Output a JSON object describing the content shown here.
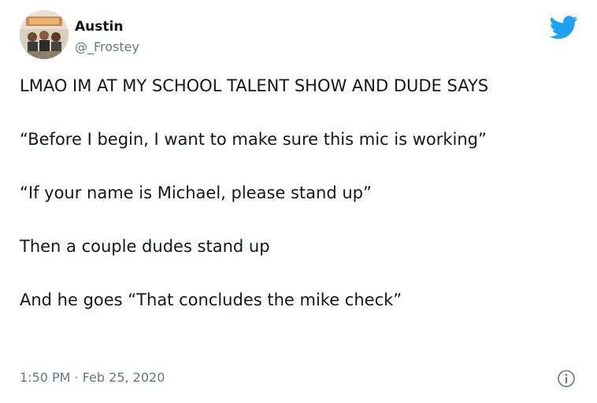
{
  "tweet": {
    "author": {
      "display_name": "Austin",
      "handle": "@_Frostey",
      "avatar_icon": "profile-photo"
    },
    "text": {
      "p1": "LMAO IM AT MY SCHOOL TALENT SHOW AND DUDE SAYS",
      "p2": "“Before I begin, I want to make sure this mic is working”",
      "p3": "“If your name is Michael, please stand up”",
      "p4": "Then a couple dudes stand up",
      "p5": "And he goes “That concludes the mike check”"
    },
    "timestamp": "1:50 PM · Feb 25, 2020"
  },
  "icons": {
    "brand": "twitter-bird-icon",
    "info": "info-icon"
  },
  "colors": {
    "text": "#14171a",
    "secondary": "#657786",
    "twitter_blue": "#1da1f2"
  }
}
